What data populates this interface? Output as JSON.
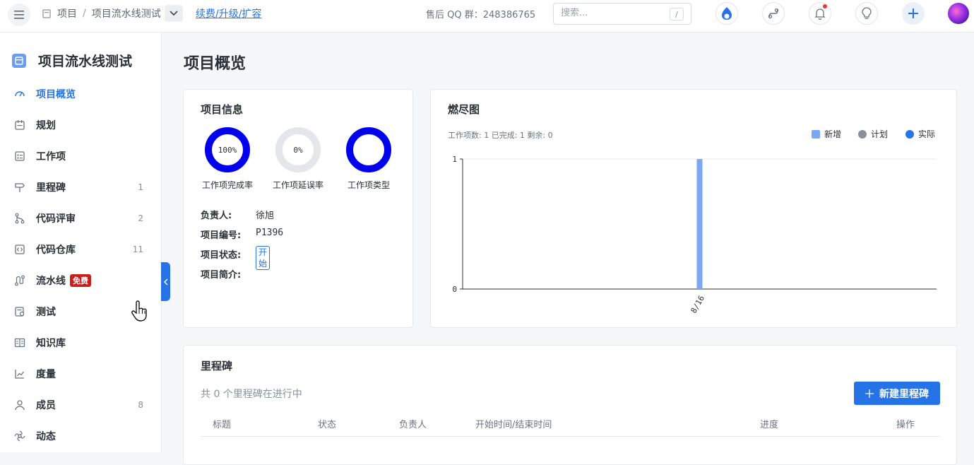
{
  "topbar": {
    "crumb_root": "项目",
    "crumb_sep": "/",
    "crumb_project": "项目流水线测试",
    "renew_link": "续费/升级/扩容",
    "qq_group": "售后 QQ 群：248386765",
    "search_placeholder": "搜索...",
    "search_shortcut": "/"
  },
  "sidebar": {
    "project_name": "项目流水线测试",
    "items": [
      {
        "label": "项目概览",
        "count": "",
        "icon": "dashboard-icon",
        "active": true
      },
      {
        "label": "规划",
        "count": "",
        "icon": "calendar-icon"
      },
      {
        "label": "工作项",
        "count": "",
        "icon": "checklist-icon"
      },
      {
        "label": "里程碑",
        "count": "1",
        "icon": "signpost-icon"
      },
      {
        "label": "代码评审",
        "count": "2",
        "icon": "merge-icon"
      },
      {
        "label": "代码仓库",
        "count": "11",
        "icon": "code-icon"
      },
      {
        "label": "流水线",
        "count": "",
        "icon": "pipeline-icon",
        "badge": "免费"
      },
      {
        "label": "测试",
        "count": "",
        "icon": "test-icon"
      },
      {
        "label": "知识库",
        "count": "",
        "icon": "book-icon"
      },
      {
        "label": "度量",
        "count": "",
        "icon": "chart-icon"
      },
      {
        "label": "成员",
        "count": "8",
        "icon": "users-icon"
      },
      {
        "label": "动态",
        "count": "",
        "icon": "activity-icon"
      }
    ]
  },
  "page": {
    "title": "项目概览"
  },
  "project_info": {
    "title": "项目信息",
    "rings": [
      {
        "value_text": "100%",
        "label": "工作项完成率",
        "fraction": 1.0
      },
      {
        "value_text": "0%",
        "label": "工作项延误率",
        "fraction": 0.0
      },
      {
        "value_text": "",
        "label": "工作项类型",
        "fraction": 1.0
      }
    ],
    "owner_label": "负责人:",
    "owner": "徐旭",
    "number_label": "项目编号:",
    "number": "P1396",
    "status_label": "项目状态:",
    "status": "开始",
    "desc_label": "项目简介:"
  },
  "burndown": {
    "title": "燃尽图",
    "stats": "工作项数: 1   已完成: 1   剩余: 0",
    "legend": [
      "新增",
      "计划",
      "实际"
    ]
  },
  "colors": {
    "accent": "#2673e8",
    "ring_blue": "#0000ee",
    "ring_grey": "#e5e6ea",
    "legend_new": "#7ba7f5",
    "legend_plan": "#8a909a",
    "legend_actual": "#2673e8",
    "badge_red": "#c8201f"
  },
  "chart_data": {
    "type": "bar",
    "title": "燃尽图",
    "categories": [
      "8/16"
    ],
    "series": [
      {
        "name": "新增",
        "values": [
          1
        ]
      },
      {
        "name": "计划",
        "values": [
          0
        ]
      },
      {
        "name": "实际",
        "values": [
          0
        ]
      }
    ],
    "ylim": [
      0,
      1
    ],
    "yticks": [
      "0",
      "1"
    ],
    "grid": true,
    "legend_position": "top-right"
  },
  "milestones": {
    "title": "里程碑",
    "summary": "共 0 个里程碑在进行中",
    "new_button": "新建里程碑",
    "columns": [
      "标题",
      "状态",
      "负责人",
      "开始时间/结束时间",
      "进度",
      "操作"
    ]
  }
}
